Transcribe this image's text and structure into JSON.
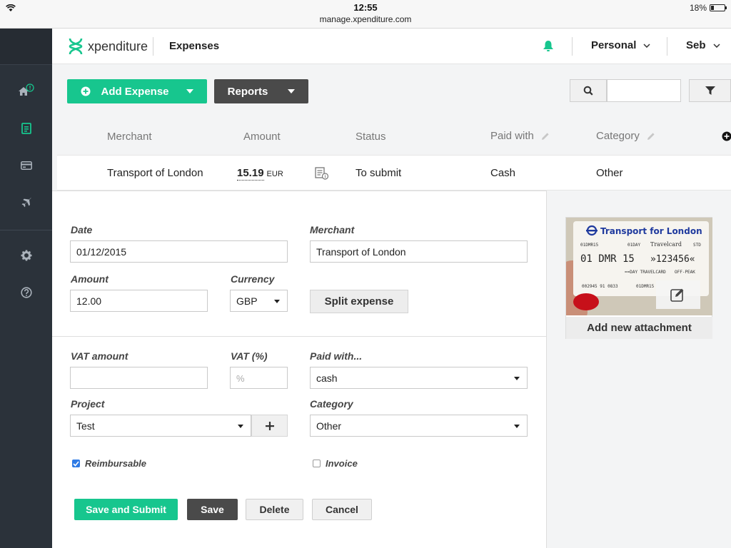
{
  "status_bar": {
    "time": "12:55",
    "url": "manage.xpenditure.com",
    "battery": "18%"
  },
  "header": {
    "logo_text": "xpenditure",
    "page_title": "Expenses",
    "account": "Personal",
    "user": "Seb"
  },
  "toolbar": {
    "add_expense": "Add Expense",
    "reports": "Reports",
    "search_value": ""
  },
  "table": {
    "columns": [
      "Merchant",
      "Amount",
      "Status",
      "Paid with",
      "Category"
    ],
    "row": {
      "merchant": "Transport of London",
      "amount": "15.19",
      "currency": "EUR",
      "status": "To submit",
      "paid_with": "Cash",
      "category": "Other"
    }
  },
  "form": {
    "date_label": "Date",
    "date_value": "01/12/2015",
    "merchant_label": "Merchant",
    "merchant_value": "Transport of London",
    "amount_label": "Amount",
    "amount_value": "12.00",
    "currency_label": "Currency",
    "currency_value": "GBP",
    "split_label": "Split expense",
    "vat_amount_label": "VAT amount",
    "vat_amount_value": "",
    "vat_pct_label": "VAT (%)",
    "vat_pct_placeholder": "%",
    "paid_with_label": "Paid with...",
    "paid_with_value": "cash",
    "project_label": "Project",
    "project_value": "Test",
    "category_label": "Category",
    "category_value": "Other",
    "reimbursable_label": "Reimbursable",
    "reimbursable_checked": true,
    "invoice_label": "Invoice",
    "invoice_checked": false
  },
  "actions": {
    "save_submit": "Save and Submit",
    "save": "Save",
    "delete": "Delete",
    "cancel": "Cancel"
  },
  "attachment": {
    "add_label": "Add new attachment",
    "receipt": {
      "brand": "Transport for London",
      "code1": "01DMR15",
      "code2": "01DAY",
      "code3": "STD",
      "travelcard": "Travelcard",
      "date": "01 DMR 15",
      "number": "»123456«",
      "ticket_type": "==DAY TRAVELCARD",
      "peak": "OFF-PEAK",
      "serial": "002945 91 0833",
      "serial2": "01DMR15"
    }
  },
  "colors": {
    "accent": "#17c68e",
    "sidebar": "#2b323a",
    "dark_button": "#4a4a4a",
    "checkbox": "#2f7be5"
  }
}
